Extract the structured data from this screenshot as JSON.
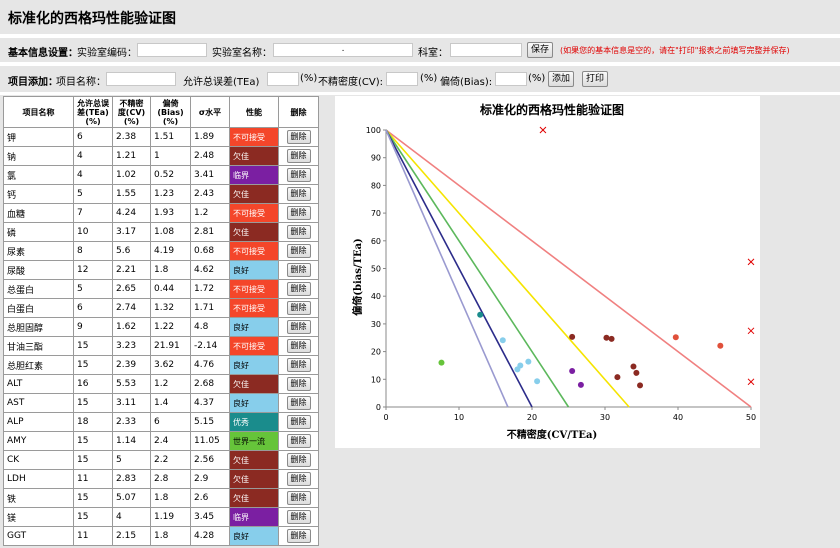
{
  "page_title": "标准化的西格玛性能验证图",
  "info": {
    "section_label": "基本信息设置：",
    "lab_code_label": "实验室编码：",
    "lab_code_value": "",
    "lab_name_label": "实验室名称：",
    "lab_name_value": ".",
    "dept_label": "科室：",
    "dept_value": "",
    "save_label": "保存",
    "note": "(如果您的基本信息是空的，请在\"打印\"报表之前填写完整并保存)"
  },
  "add": {
    "section_label": "项目添加：",
    "name_label": "项目名称：",
    "name_value": "",
    "tea_label": "允许总误差(TEa)",
    "tea_unit": "(%)",
    "cv_label": "不精密度(CV):",
    "cv_unit": "(%)",
    "bias_label": "偏倚(Bias):",
    "bias_unit": "(%)",
    "add_label": "添加",
    "print_label": "打印"
  },
  "table": {
    "headers": [
      "项目名称",
      "允许总误差(TEa)(%)",
      "不精密度(CV)(%)",
      "偏倚(Bias)(%)",
      "σ水平",
      "性能",
      "删除"
    ],
    "delete_label": "删除",
    "rows": [
      {
        "name": "钾",
        "tea": "6",
        "cv": "2.38",
        "bias": "1.51",
        "sigma": "1.89",
        "perf": "不可接受"
      },
      {
        "name": "钠",
        "tea": "4",
        "cv": "1.21",
        "bias": "1",
        "sigma": "2.48",
        "perf": "欠佳"
      },
      {
        "name": "氯",
        "tea": "4",
        "cv": "1.02",
        "bias": "0.52",
        "sigma": "3.41",
        "perf": "临界"
      },
      {
        "name": "钙",
        "tea": "5",
        "cv": "1.55",
        "bias": "1.23",
        "sigma": "2.43",
        "perf": "欠佳"
      },
      {
        "name": "血糖",
        "tea": "7",
        "cv": "4.24",
        "bias": "1.93",
        "sigma": "1.2",
        "perf": "不可接受"
      },
      {
        "name": "磷",
        "tea": "10",
        "cv": "3.17",
        "bias": "1.08",
        "sigma": "2.81",
        "perf": "欠佳"
      },
      {
        "name": "尿素",
        "tea": "8",
        "cv": "5.6",
        "bias": "4.19",
        "sigma": "0.68",
        "perf": "不可接受"
      },
      {
        "name": "尿酸",
        "tea": "12",
        "cv": "2.21",
        "bias": "1.8",
        "sigma": "4.62",
        "perf": "良好"
      },
      {
        "name": "总蛋白",
        "tea": "5",
        "cv": "2.65",
        "bias": "0.44",
        "sigma": "1.72",
        "perf": "不可接受"
      },
      {
        "name": "白蛋白",
        "tea": "6",
        "cv": "2.74",
        "bias": "1.32",
        "sigma": "1.71",
        "perf": "不可接受"
      },
      {
        "name": "总胆固醇",
        "tea": "9",
        "cv": "1.62",
        "bias": "1.22",
        "sigma": "4.8",
        "perf": "良好"
      },
      {
        "name": "甘油三酯",
        "tea": "15",
        "cv": "3.23",
        "bias": "21.91",
        "sigma": "-2.14",
        "perf": "不可接受"
      },
      {
        "name": "总胆红素",
        "tea": "15",
        "cv": "2.39",
        "bias": "3.62",
        "sigma": "4.76",
        "perf": "良好"
      },
      {
        "name": "ALT",
        "tea": "16",
        "cv": "5.53",
        "bias": "1.2",
        "sigma": "2.68",
        "perf": "欠佳"
      },
      {
        "name": "AST",
        "tea": "15",
        "cv": "3.11",
        "bias": "1.4",
        "sigma": "4.37",
        "perf": "良好"
      },
      {
        "name": "ALP",
        "tea": "18",
        "cv": "2.33",
        "bias": "6",
        "sigma": "5.15",
        "perf": "优秀"
      },
      {
        "name": "AMY",
        "tea": "15",
        "cv": "1.14",
        "bias": "2.4",
        "sigma": "11.05",
        "perf": "世界一流"
      },
      {
        "name": "CK",
        "tea": "15",
        "cv": "5",
        "bias": "2.2",
        "sigma": "2.56",
        "perf": "欠佳"
      },
      {
        "name": "LDH",
        "tea": "11",
        "cv": "2.83",
        "bias": "2.8",
        "sigma": "2.9",
        "perf": "欠佳"
      },
      {
        "name": "铁",
        "tea": "15",
        "cv": "5.07",
        "bias": "1.8",
        "sigma": "2.6",
        "perf": "欠佳"
      },
      {
        "name": "镁",
        "tea": "15",
        "cv": "4",
        "bias": "1.19",
        "sigma": "3.45",
        "perf": "临界"
      },
      {
        "name": "GGT",
        "tea": "11",
        "cv": "2.15",
        "bias": "1.8",
        "sigma": "4.28",
        "perf": "良好"
      }
    ]
  },
  "perf_colors": {
    "不可接受": "#f4462a",
    "欠佳": "#8b2a22",
    "临界": "#7b1fa2",
    "良好": "#87ceeb",
    "优秀": "#1a8c8c",
    "世界一流": "#66c43a"
  },
  "chart_data": {
    "type": "scatter",
    "title": "标准化的西格玛性能验证图",
    "xlabel": "不精密度(CV/TEa)",
    "ylabel": "偏倚(bias/TEa)",
    "xlim": [
      0,
      50
    ],
    "ylim": [
      0,
      100
    ],
    "xticks": [
      0,
      10,
      20,
      30,
      40,
      50
    ],
    "yticks": [
      0,
      10,
      20,
      30,
      40,
      50,
      60,
      70,
      80,
      90,
      100
    ],
    "grid": false,
    "sigma_lines": [
      {
        "x_intercept": 50,
        "color": "#f08080"
      },
      {
        "x_intercept": 33.3,
        "color": "#f5e400"
      },
      {
        "x_intercept": 25,
        "color": "#5cb85c"
      },
      {
        "x_intercept": 20,
        "color": "#2c2c8a"
      },
      {
        "x_intercept": 16.7,
        "color": "#9a9ad0"
      }
    ],
    "points": [
      {
        "x": 39.7,
        "y": 25.2,
        "color": "#e0503a",
        "marker": "dot"
      },
      {
        "x": 45.8,
        "y": 22.1,
        "color": "#e0503a",
        "marker": "dot"
      },
      {
        "x": 30.2,
        "y": 25.0,
        "color": "#8b2a22",
        "marker": "dot"
      },
      {
        "x": 30.9,
        "y": 24.6,
        "color": "#8b2a22",
        "marker": "dot"
      },
      {
        "x": 25.5,
        "y": 25.3,
        "color": "#8b2a22",
        "marker": "dot"
      },
      {
        "x": 33.9,
        "y": 14.6,
        "color": "#8b2a22",
        "marker": "dot"
      },
      {
        "x": 34.3,
        "y": 12.3,
        "color": "#8b2a22",
        "marker": "dot"
      },
      {
        "x": 31.7,
        "y": 10.8,
        "color": "#8b2a22",
        "marker": "dot"
      },
      {
        "x": 34.8,
        "y": 7.8,
        "color": "#8b2a22",
        "marker": "dot"
      },
      {
        "x": 25.5,
        "y": 13.0,
        "color": "#7b1fa2",
        "marker": "dot"
      },
      {
        "x": 26.7,
        "y": 8.0,
        "color": "#7b1fa2",
        "marker": "dot"
      },
      {
        "x": 12.9,
        "y": 33.3,
        "color": "#1a8c8c",
        "marker": "dot"
      },
      {
        "x": 7.6,
        "y": 16.0,
        "color": "#66c43a",
        "marker": "dot"
      },
      {
        "x": 16.0,
        "y": 24.1,
        "color": "#87ceeb",
        "marker": "dot"
      },
      {
        "x": 18.0,
        "y": 13.6,
        "color": "#87ceeb",
        "marker": "dot"
      },
      {
        "x": 18.4,
        "y": 15.0,
        "color": "#87ceeb",
        "marker": "dot"
      },
      {
        "x": 19.5,
        "y": 16.4,
        "color": "#87ceeb",
        "marker": "dot"
      },
      {
        "x": 20.7,
        "y": 9.3,
        "color": "#87ceeb",
        "marker": "dot"
      },
      {
        "x": 21.5,
        "y": 100.0,
        "color": "#e00000",
        "marker": "x"
      },
      {
        "x": 50.0,
        "y": 52.4,
        "color": "#e00000",
        "marker": "x"
      },
      {
        "x": 50.0,
        "y": 27.5,
        "color": "#e00000",
        "marker": "x"
      },
      {
        "x": 50.0,
        "y": 9.1,
        "color": "#e00000",
        "marker": "x"
      }
    ]
  }
}
